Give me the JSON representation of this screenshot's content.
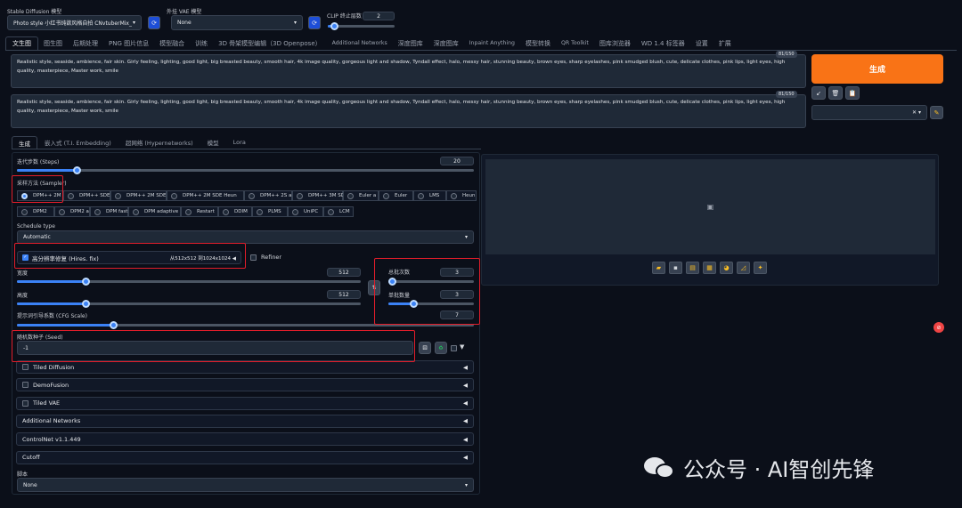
{
  "top": {
    "sd_model_label": "Stable Diffusion 模型",
    "sd_model_value": "Photo style 小红书纯欲风格自拍 CNvtuberMix_",
    "vae_label": "外挂 VAE 模型",
    "vae_value": "None",
    "clip_label": "CLIP 终止层数",
    "clip_value": "2"
  },
  "main_tabs": [
    "文生图",
    "图生图",
    "后期处理",
    "PNG 图片信息",
    "模型融合",
    "训练",
    "3D 骨架模型编辑（3D Openpose）",
    "Additional Networks",
    "深度图库",
    "深度图库",
    "Inpaint Anything",
    "模型转换",
    "QR Toolkit",
    "图库浏览器",
    "WD 1.4 标签器",
    "设置",
    "扩展"
  ],
  "prompt": {
    "positive": "Realistic style, seaside, ambience, fair skin. Girly feeling, lighting, good light, big breasted beauty, smooth hair, 4k image quality, gorgeous light and shadow, Tyndall effect, halo, messy hair, stunning beauty, brown eyes, sharp eyelashes, pink smudged blush, cute, delicate clothes, pink lips, light eyes, high quality, masterpiece, Master work, smile",
    "positive_count": "81/150",
    "negative": "Realistic style, seaside, ambience, fair skin. Girly feeling, lighting, good light, big breasted beauty, smooth hair, 4k image quality, gorgeous light and shadow, Tyndall effect, halo, messy hair, stunning beauty, brown eyes, sharp eyelashes, pink smudged blush, cute, delicate clothes, pink lips, light eyes, high quality, masterpiece, Master work, smile",
    "negative_count": "81/150"
  },
  "generate_label": "生成",
  "sub_tabs": [
    "生成",
    "嵌入式 (T.I. Embedding)",
    "超网络 (Hypernetworks)",
    "模型",
    "Lora"
  ],
  "steps": {
    "label": "迭代步数 (Steps)",
    "value": "20",
    "fraction": 0.13
  },
  "sampler": {
    "label": "采样方法 (Sampler)",
    "row1": [
      "DPM++ 2M",
      "DPM++ SDE",
      "DPM++ 2M SDE",
      "DPM++ 2M SDE Heun",
      "DPM++ 2S a",
      "DPM++ 3M SDE",
      "Euler a",
      "Euler",
      "LMS",
      "Heun"
    ],
    "row2": [
      "DPM2",
      "DPM2 a",
      "DPM fast",
      "DPM adaptive",
      "Restart",
      "DDIM",
      "PLMS",
      "UniPC",
      "LCM"
    ],
    "selected": "DPM++ 2M"
  },
  "schedule": {
    "label": "Schedule type",
    "value": "Automatic"
  },
  "hires": {
    "label": "高分辨率修复 (Hires. fix)",
    "detail": "从512x512 到1024x1024"
  },
  "refiner_label": "Refiner",
  "width": {
    "label": "宽度",
    "value": "512",
    "fraction": 0.2
  },
  "height": {
    "label": "高度",
    "value": "512",
    "fraction": 0.2
  },
  "batch_count": {
    "label": "总批次数",
    "value": "3",
    "fraction": 0.03
  },
  "batch_size": {
    "label": "单批数量",
    "value": "3",
    "fraction": 0.29
  },
  "cfg": {
    "label": "提示词引导系数 (CFG Scale)",
    "value": "7",
    "fraction": 0.21
  },
  "swap_icon": "⇅",
  "seed": {
    "label": "随机数种子 (Seed)",
    "value": "-1"
  },
  "accordions": [
    "Tiled Diffusion",
    "DemoFusion",
    "Tiled VAE",
    "Additional Networks",
    "ControlNet v1.1.449",
    "Cutoff"
  ],
  "script": {
    "label": "脚本",
    "value": "None"
  },
  "watermark": "公众号 · AI智创先锋",
  "colors": {
    "accent": "#3b82f6",
    "generate": "#f97316",
    "highlight": "#e11d2a",
    "background": "#0b0f19"
  }
}
